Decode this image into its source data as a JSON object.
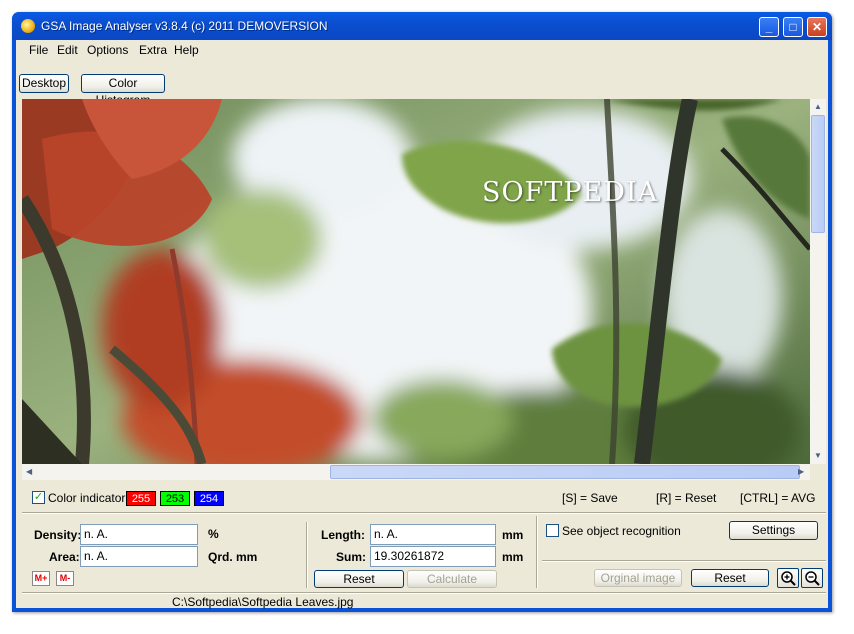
{
  "window": {
    "title": "GSA Image Analyser v3.8.4 (c) 2011   DEMOVERSION",
    "minimize": "_",
    "maximize": "□",
    "close": "✕"
  },
  "menu": {
    "file": "File",
    "edit": "Edit",
    "options": "Options",
    "extra": "Extra",
    "help": "Help"
  },
  "tabs": {
    "desktop": "Desktop",
    "histogram": "Color Histogram"
  },
  "image": {
    "watermark": "SOFTPEDIA"
  },
  "color_bar": {
    "indicator_label": "Color indicator",
    "indicator_checked": true,
    "r": "255",
    "g": "253",
    "b": "254",
    "hint_save": "[S] = Save",
    "hint_reset": "[R] = Reset",
    "hint_avg": "[CTRL] = AVG"
  },
  "measure": {
    "density_label": "Density:",
    "density_value": "n. A.",
    "density_unit": "%",
    "area_label": "Area:",
    "area_value": "n. A.",
    "area_unit": "Qrd. mm",
    "mplus": "M+",
    "mminus": "M-",
    "length_label": "Length:",
    "length_value": "n. A.",
    "length_unit": "mm",
    "sum_label": "Sum:",
    "sum_value": "19.30261872",
    "sum_unit": "mm",
    "reset": "Reset",
    "calculate": "Calculate"
  },
  "object": {
    "see_label": "See object recognition",
    "settings": "Settings",
    "original": "Orginal image",
    "reset": "Reset"
  },
  "status": {
    "path": "C:\\Softpedia\\Softpedia Leaves.jpg"
  },
  "colors": {
    "title_blue": "#0a53d8",
    "red_box": "#ff0000",
    "green_box": "#00ff00",
    "blue_box": "#0000ff"
  }
}
